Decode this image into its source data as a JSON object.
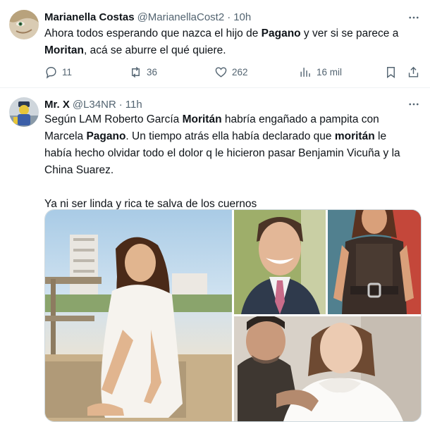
{
  "tweet1": {
    "name": "Marianella Costas",
    "handle": "@MarianellaCost2",
    "separator": "·",
    "time": "10h",
    "text_runs": [
      {
        "t": "Ahora todos esperando que nazca el hijo de ",
        "b": false
      },
      {
        "t": "Pagano",
        "b": true
      },
      {
        "t": " y ver si se parece a ",
        "b": false
      },
      {
        "br": true
      },
      {
        "t": "Moritan",
        "b": true
      },
      {
        "t": ", acá se aburre el qué quiere.",
        "b": false
      }
    ],
    "replies": "11",
    "reposts": "36",
    "likes": "262",
    "views": "16 mil",
    "icons": [
      "more-icon",
      "reply-icon",
      "repost-icon",
      "like-icon",
      "views-icon",
      "bookmark-icon",
      "share-icon"
    ]
  },
  "tweet2": {
    "name": "Mr. X",
    "handle": "@L34NR",
    "separator": "·",
    "time": "11h",
    "text_runs": [
      {
        "t": "Según LAM Roberto García ",
        "b": false
      },
      {
        "t": "Moritán",
        "b": true
      },
      {
        "t": " habría engañado a pampita con",
        "b": false
      },
      {
        "br": true
      },
      {
        "t": "Marcela ",
        "b": false
      },
      {
        "t": "Pagano",
        "b": true
      },
      {
        "t": ". Un tiempo atrás ella había declarado que ",
        "b": false
      },
      {
        "t": "moritán",
        "b": true
      },
      {
        "t": " le",
        "b": false
      },
      {
        "br": true
      },
      {
        "t": "había hecho olvidar todo el dolor q le hicieron pasar  Benjamin Vicuña y la",
        "b": false
      },
      {
        "br": true
      },
      {
        "t": "China Suarez.",
        "b": false
      },
      {
        "br": true
      },
      {
        "br": true
      },
      {
        "t": "Ya ni ser linda y rica te salva de los cuernos",
        "b": false
      }
    ],
    "media_photos": [
      "photo-woman-beach",
      "photo-man-smiling",
      "photo-woman-vest",
      "photo-couple-selfie"
    ]
  },
  "colors": {
    "text": "#0f1419",
    "muted": "#536471",
    "border": "#cfd9de"
  }
}
